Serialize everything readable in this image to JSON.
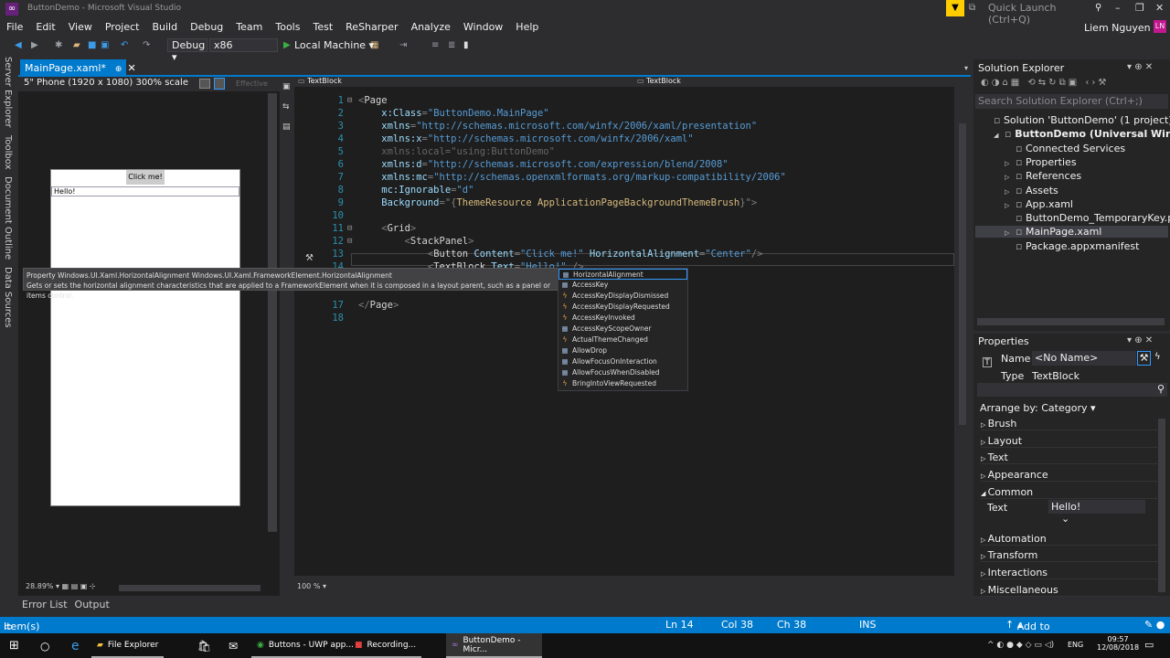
{
  "window": {
    "title": "ButtonDemo - Microsoft Visual Studio",
    "quick_launch_placeholder": "Quick Launch (Ctrl+Q)",
    "user": "Liem Nguyen",
    "user_initials": "LN"
  },
  "menu": [
    "File",
    "Edit",
    "View",
    "Project",
    "Build",
    "Debug",
    "Team",
    "Tools",
    "Test",
    "ReSharper",
    "Analyze",
    "Window",
    "Help"
  ],
  "toolbar": {
    "configuration": "Debug",
    "platform": "x86",
    "run_target": "Local Machine"
  },
  "side_tabs": [
    "Server Explorer",
    "Toolbox",
    "Document Outline",
    "Data Sources"
  ],
  "document_tab": {
    "label": "MainPage.xaml*"
  },
  "designer": {
    "device": "5\" Phone (1920 x 1080) 300% scale",
    "effective": "Effective",
    "button_text": "Click me!",
    "textblock_text": "Hello!",
    "zoom": "28.89%"
  },
  "editor": {
    "breadcrumb_left": "TextBlock",
    "breadcrumb_right": "TextBlock",
    "zoom": "100 %",
    "lines": [
      {
        "n": "1",
        "tokens": [
          [
            "punct",
            "<"
          ],
          [
            "tag",
            "Page"
          ]
        ]
      },
      {
        "n": "2",
        "tokens": [
          [
            "attr",
            "    x:Class"
          ],
          [
            "punct",
            "="
          ],
          [
            "val",
            "\"ButtonDemo.MainPage\""
          ]
        ]
      },
      {
        "n": "3",
        "tokens": [
          [
            "attr",
            "    xmlns"
          ],
          [
            "punct",
            "="
          ],
          [
            "val",
            "\"http://schemas.microsoft.com/winfx/2006/xaml/presentation\""
          ]
        ]
      },
      {
        "n": "4",
        "tokens": [
          [
            "attr",
            "    xmlns:x"
          ],
          [
            "punct",
            "="
          ],
          [
            "val",
            "\"http://schemas.microsoft.com/winfx/2006/xaml\""
          ]
        ]
      },
      {
        "n": "5",
        "tokens": [
          [
            "dim",
            "    xmlns:local=\"using:ButtonDemo\""
          ]
        ]
      },
      {
        "n": "6",
        "tokens": [
          [
            "attr",
            "    xmlns:d"
          ],
          [
            "punct",
            "="
          ],
          [
            "val",
            "\"http://schemas.microsoft.com/expression/blend/2008\""
          ]
        ]
      },
      {
        "n": "7",
        "tokens": [
          [
            "attr",
            "    xmlns:mc"
          ],
          [
            "punct",
            "="
          ],
          [
            "val",
            "\"http://schemas.openxmlformats.org/markup-compatibility/2006\""
          ]
        ]
      },
      {
        "n": "8",
        "tokens": [
          [
            "attr",
            "    mc:Ignorable"
          ],
          [
            "punct",
            "="
          ],
          [
            "val",
            "\"d\""
          ]
        ]
      },
      {
        "n": "9",
        "tokens": [
          [
            "attr",
            "    Background"
          ],
          [
            "punct",
            "=\"{"
          ],
          [
            "ext",
            "ThemeResource ApplicationPageBackgroundThemeBrush"
          ],
          [
            "punct",
            "}\">"
          ]
        ]
      },
      {
        "n": "10",
        "tokens": []
      },
      {
        "n": "11",
        "tokens": [
          [
            "punct",
            "    <"
          ],
          [
            "tag",
            "Grid"
          ],
          [
            "punct",
            ">"
          ]
        ]
      },
      {
        "n": "12",
        "tokens": [
          [
            "punct",
            "        <"
          ],
          [
            "tag",
            "StackPanel"
          ],
          [
            "punct",
            ">"
          ]
        ]
      },
      {
        "n": "13",
        "tokens": [
          [
            "punct",
            "            <"
          ],
          [
            "tag",
            "Button "
          ],
          [
            "attr",
            "Content"
          ],
          [
            "punct",
            "="
          ],
          [
            "val",
            "\"Click me!\" "
          ],
          [
            "attr",
            "HorizontalAlignment"
          ],
          [
            "punct",
            "="
          ],
          [
            "val",
            "\"Center\""
          ],
          [
            "punct",
            "/>"
          ]
        ]
      },
      {
        "n": "14",
        "tokens": [
          [
            "punct",
            "            <"
          ],
          [
            "tag",
            "TextBlock "
          ],
          [
            "attr",
            "Text"
          ],
          [
            "punct",
            "="
          ],
          [
            "val",
            "\"Hello!\" "
          ],
          [
            "punct",
            "/>"
          ]
        ]
      },
      {
        "n": "17",
        "tokens": [
          [
            "punct",
            "</"
          ],
          [
            "tag",
            "Page"
          ],
          [
            "punct",
            ">"
          ]
        ]
      },
      {
        "n": "18",
        "tokens": []
      }
    ]
  },
  "tooltip": {
    "line1": "Property Windows.UI.Xaml.HorizontalAlignment Windows.UI.Xaml.FrameworkElement.HorizontalAlignment",
    "line2": "Gets or sets the horizontal alignment characteristics that are applied to a FrameworkElement when it is composed in a layout parent, such as a panel or items control."
  },
  "intellisense": [
    {
      "label": "HorizontalAlignment",
      "kind": "property"
    },
    {
      "label": "AccessKey",
      "kind": "property"
    },
    {
      "label": "AccessKeyDisplayDismissed",
      "kind": "event"
    },
    {
      "label": "AccessKeyDisplayRequested",
      "kind": "event"
    },
    {
      "label": "AccessKeyInvoked",
      "kind": "event"
    },
    {
      "label": "AccessKeyScopeOwner",
      "kind": "property"
    },
    {
      "label": "ActualThemeChanged",
      "kind": "event"
    },
    {
      "label": "AllowDrop",
      "kind": "property"
    },
    {
      "label": "AllowFocusOnInteraction",
      "kind": "property"
    },
    {
      "label": "AllowFocusWhenDisabled",
      "kind": "property"
    },
    {
      "label": "BringIntoViewRequested",
      "kind": "event"
    }
  ],
  "solution_explorer": {
    "title": "Solution Explorer",
    "search_placeholder": "Search Solution Explorer (Ctrl+;)",
    "items": [
      {
        "label": "Solution 'ButtonDemo' (1 project)",
        "indent": 0,
        "arrow": ""
      },
      {
        "label": "ButtonDemo (Universal Windows)",
        "indent": 1,
        "arrow": "◢",
        "bold": true
      },
      {
        "label": "Connected Services",
        "indent": 2,
        "arrow": ""
      },
      {
        "label": "Properties",
        "indent": 2,
        "arrow": "▷"
      },
      {
        "label": "References",
        "indent": 2,
        "arrow": "▷"
      },
      {
        "label": "Assets",
        "indent": 2,
        "arrow": "▷"
      },
      {
        "label": "App.xaml",
        "indent": 2,
        "arrow": "▷"
      },
      {
        "label": "ButtonDemo_TemporaryKey.pfx",
        "indent": 2,
        "arrow": ""
      },
      {
        "label": "MainPage.xaml",
        "indent": 2,
        "arrow": "▷",
        "selected": true
      },
      {
        "label": "Package.appxmanifest",
        "indent": 2,
        "arrow": ""
      }
    ]
  },
  "properties": {
    "title": "Properties",
    "name_label": "Name",
    "name_value": "<No Name>",
    "type_label": "Type",
    "type_value": "TextBlock",
    "arrange_by": "Arrange by: Category",
    "categories_before": [
      "Brush",
      "Layout",
      "Text",
      "Appearance"
    ],
    "common": {
      "label": "Common",
      "text_label": "Text",
      "text_value": "Hello!"
    },
    "categories_after": [
      "Automation",
      "Transform",
      "Interactions",
      "Miscellaneous"
    ]
  },
  "bottom_tabs": [
    "Error List",
    "Output"
  ],
  "status": {
    "message": "Item(s) Saved",
    "ln": "Ln 14",
    "col": "Col 38",
    "ch": "Ch 38",
    "mode": "INS",
    "source_control": "Add to Source Control"
  },
  "taskbar": {
    "items": [
      "File Explorer",
      "Buttons - UWP app...",
      "Recording...",
      "ButtonDemo - Micr..."
    ],
    "lang": "ENG",
    "time": "09:57",
    "date": "12/08/2018"
  }
}
